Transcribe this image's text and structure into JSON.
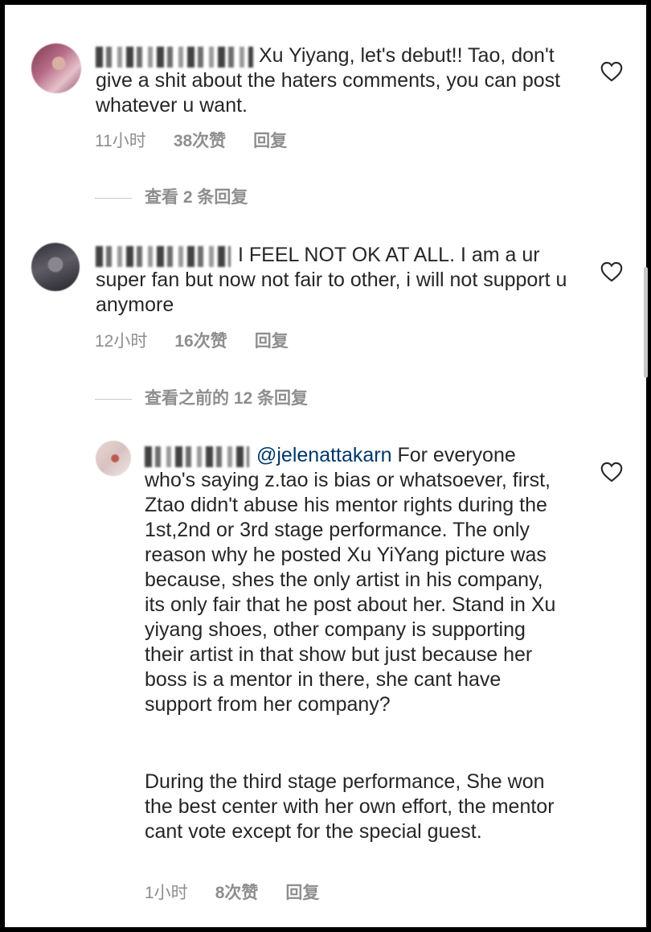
{
  "comments": [
    {
      "text": "Xu Yiyang, let's debut!! Tao, don't give a shit about the haters comments, you can post whatever u want.",
      "time": "11小时",
      "likes": "38次赞",
      "reply": "回复",
      "view_replies": "查看 2 条回复"
    },
    {
      "text": "I FEEL NOT OK AT ALL. I am a ur super fan but now not fair to other, i will not support u anymore",
      "time": "12小时",
      "likes": "16次赞",
      "reply": "回复",
      "view_replies": "查看之前的 12 条回复"
    },
    {
      "mention": "@jelenattakarn",
      "text": " For everyone who's saying z.tao is bias or whatsoever, first, Ztao didn't abuse his mentor rights during the 1st,2nd or 3rd stage performance. The only reason why he posted Xu YiYang picture was because, shes the only artist in his company, its only fair that he post about her. Stand in Xu yiyang shoes, other company is supporting their artist in that show but just because her boss is a mentor in there, she cant have support from her company?",
      "text2": "During the third stage performance, She won the best center with her own effort, the mentor cant vote except for the special guest.",
      "time": "1小时",
      "likes": "8次赞",
      "reply": "回复"
    }
  ],
  "icons": {
    "like": "heart-outline-icon"
  },
  "colors": {
    "text": "#262626",
    "meta": "#8e8e8e",
    "mention": "#00376b"
  }
}
